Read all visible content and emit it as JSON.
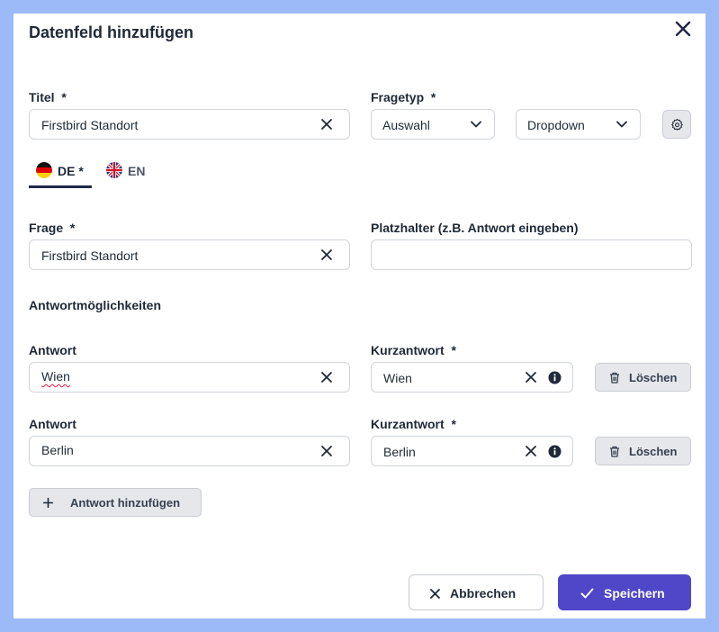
{
  "dialog": {
    "title": "Datenfeld hinzufügen",
    "close_icon": "close-icon"
  },
  "titel": {
    "label": "Titel",
    "required": "*",
    "value": "Firstbird Standort"
  },
  "fragetyp": {
    "label": "Fragetyp",
    "required": "*",
    "type_value": "Auswahl",
    "display_value": "Dropdown",
    "settings_icon": "gear-icon"
  },
  "tabs": [
    {
      "label": "DE *",
      "flag": "germany-flag-icon",
      "active": true
    },
    {
      "label": "EN",
      "flag": "uk-flag-icon",
      "active": false
    }
  ],
  "frage": {
    "label": "Frage",
    "required": "*",
    "value": "Firstbird Standort"
  },
  "platzhalter": {
    "label": "Platzhalter (z.B. Antwort eingeben)",
    "value": ""
  },
  "answers_section": {
    "heading": "Antwortmöglichkeiten",
    "answer_label": "Antwort",
    "short_label": "Kurzantwort",
    "required": "*",
    "delete_label": "Löschen",
    "items": [
      {
        "answer": "Wien",
        "short": "Wien"
      },
      {
        "answer": "Berlin",
        "short": "Berlin"
      }
    ],
    "add_label": "Antwort hinzufügen"
  },
  "footer": {
    "cancel_label": "Abbrechen",
    "save_label": "Speichern"
  },
  "colors": {
    "backdrop": "#9cbaf7",
    "primary": "#4f46c8",
    "tab_underline": "#1f2a44"
  }
}
